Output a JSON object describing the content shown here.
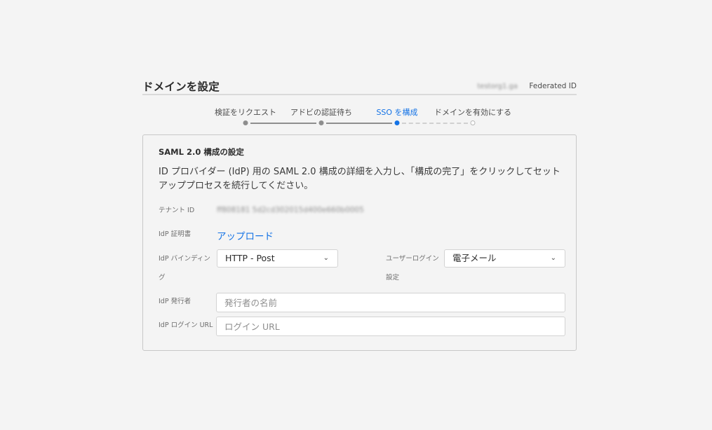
{
  "header": {
    "title": "ドメインを設定",
    "domain": "testorg1.ga",
    "id_type": "Federated ID"
  },
  "stepper": {
    "steps": [
      {
        "label": "検証をリクエスト",
        "state": "done"
      },
      {
        "label": "アドビの認証待ち",
        "state": "done"
      },
      {
        "label": "SSO を構成",
        "state": "active"
      },
      {
        "label": "ドメインを有効にする",
        "state": "pending"
      }
    ]
  },
  "panel": {
    "title": "SAML 2.0 構成の設定",
    "description": "ID プロバイダー (IdP) 用の SAML 2.0 構成の詳細を入力し、「構成の完了」をクリックしてセットアッププロセスを続行してください。",
    "tenant_id_label": "テナント ID",
    "tenant_id_value": "ff808181 5d2cd302015d400e660b0005",
    "idp_cert_label": "IdP 証明書",
    "upload_label": "アップロード",
    "idp_binding_label": "IdP バインディング",
    "idp_binding_value": "HTTP - Post",
    "user_login_label": "ユーザーログイン設定",
    "user_login_value": "電子メール",
    "idp_issuer_label": "IdP 発行者",
    "idp_issuer_placeholder": "発行者の名前",
    "idp_login_url_label": "IdP ログイン URL",
    "idp_login_url_placeholder": "ログイン URL"
  },
  "icons": {
    "dropdown": "chevron-down-icon"
  },
  "colors": {
    "accent": "#1473e6",
    "done": "#8e8e8e",
    "pending": "#d0d0d0"
  }
}
